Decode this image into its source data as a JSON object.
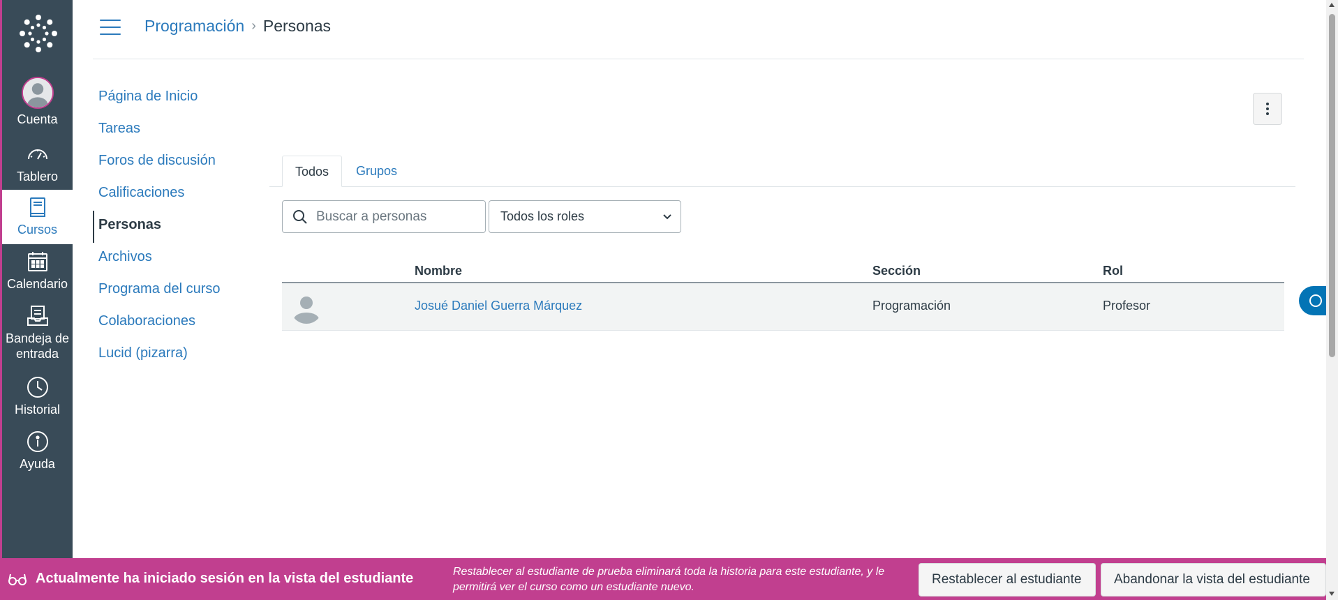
{
  "global_nav": {
    "items": [
      {
        "label": "Cuenta",
        "icon": "account-avatar-icon"
      },
      {
        "label": "Tablero",
        "icon": "dashboard-icon"
      },
      {
        "label": "Cursos",
        "icon": "courses-icon",
        "active": true
      },
      {
        "label": "Calendario",
        "icon": "calendar-icon"
      },
      {
        "label": "Bandeja de entrada",
        "icon": "inbox-icon"
      },
      {
        "label": "Historial",
        "icon": "history-clock-icon"
      },
      {
        "label": "Ayuda",
        "icon": "help-icon"
      }
    ]
  },
  "breadcrumb": {
    "course": "Programación",
    "separator": "›",
    "current": "Personas"
  },
  "course_nav": {
    "items": [
      {
        "label": "Página de Inicio"
      },
      {
        "label": "Tareas"
      },
      {
        "label": "Foros de discusión"
      },
      {
        "label": "Calificaciones"
      },
      {
        "label": "Personas",
        "active": true
      },
      {
        "label": "Archivos"
      },
      {
        "label": "Programa del curso"
      },
      {
        "label": "Colaboraciones"
      },
      {
        "label": "Lucid (pizarra)"
      }
    ]
  },
  "tabs": [
    {
      "label": "Todos",
      "active": true
    },
    {
      "label": "Grupos"
    }
  ],
  "search": {
    "placeholder": "Buscar a personas",
    "value": ""
  },
  "role_filter": {
    "selected": "Todos los roles"
  },
  "table": {
    "headers": {
      "name": "Nombre",
      "section": "Sección",
      "role": "Rol"
    },
    "rows": [
      {
        "name": "Josué Daniel Guerra Márquez",
        "section": "Programación",
        "role": "Profesor"
      }
    ]
  },
  "student_view": {
    "title": "Actualmente ha iniciado sesión en la vista del estudiante",
    "description": "Restablecer al estudiante de prueba eliminará toda la historia para este estudiante, y le permitirá ver el curso como un estudiante nuevo.",
    "reset_label": "Restablecer al estudiante",
    "leave_label": "Abandonar la vista del estudiante"
  },
  "colors": {
    "nav_bg": "#394b58",
    "link": "#2b7abc",
    "student_bar": "#c13f8f",
    "bubble": "#0374b5"
  }
}
